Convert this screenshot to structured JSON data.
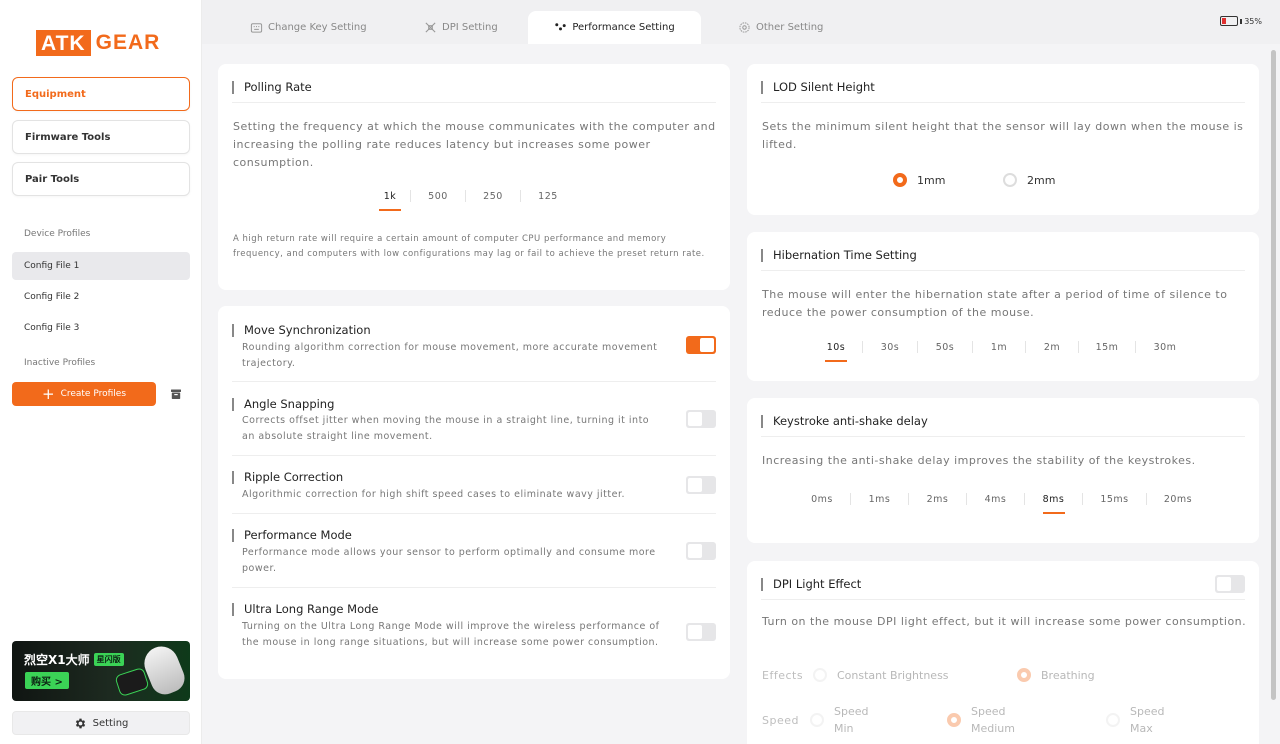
{
  "brand": {
    "logo_left": "ATK",
    "logo_right": "GEAR",
    "accent": "#f26a1b"
  },
  "sidebar": {
    "nav": [
      {
        "label": "Equipment",
        "active": true
      },
      {
        "label": "Firmware Tools"
      },
      {
        "label": "Pair Tools"
      }
    ],
    "device_profiles_label": "Device Profiles",
    "profiles": [
      {
        "label": "Config File 1",
        "active": true
      },
      {
        "label": "Config File 2"
      },
      {
        "label": "Config File 3"
      }
    ],
    "inactive_profiles_label": "Inactive Profiles",
    "create_label": "Create Profiles",
    "banner": {
      "title": "烈空X1大师",
      "badge": "星闪版",
      "buy": "购买 >"
    },
    "setting_label": "Setting"
  },
  "tabs": [
    {
      "label": "Change Key Setting",
      "icon": "keyboard-icon"
    },
    {
      "label": "DPI Setting",
      "icon": "dpi-icon"
    },
    {
      "label": "Performance Setting",
      "icon": "performance-icon",
      "active": true
    },
    {
      "label": "Other Setting",
      "icon": "gear-icon"
    }
  ],
  "battery": {
    "text": "35%",
    "level": 0.35
  },
  "polling": {
    "title": "Polling Rate",
    "desc": "Setting the frequency at which the mouse communicates with the computer and increasing the polling rate reduces latency but increases some power consumption.",
    "options": [
      "1k",
      "500",
      "250",
      "125"
    ],
    "selected": "1k",
    "note": "A high return rate will require a certain amount of computer CPU performance and memory frequency, and computers with low configurations may lag or fail to achieve the preset return rate."
  },
  "toggles": [
    {
      "title": "Move Synchronization",
      "desc": "Rounding algorithm correction for mouse movement, more accurate movement trajectory.",
      "on": true
    },
    {
      "title": "Angle Snapping",
      "desc": "Corrects offset jitter when moving the mouse in a straight line, turning it into an absolute straight line movement.",
      "on": false
    },
    {
      "title": "Ripple Correction",
      "desc": "Algorithmic correction for high shift speed cases to eliminate wavy jitter.",
      "on": false
    },
    {
      "title": "Performance Mode",
      "desc": "Performance mode allows your sensor to perform optimally and consume more power.",
      "on": false
    },
    {
      "title": "Ultra Long Range Mode",
      "desc": "Turning on the Ultra Long Range Mode will improve the wireless performance of the mouse in long range situations, but will increase some power consumption.",
      "on": false
    }
  ],
  "lod": {
    "title": "LOD Silent Height",
    "desc": "Sets the minimum silent height that the sensor will lay down when the mouse is lifted.",
    "options": [
      "1mm",
      "2mm"
    ],
    "selected": "1mm"
  },
  "hibernation": {
    "title": "Hibernation Time Setting",
    "desc": "The mouse will enter the hibernation state after a period of time of silence to reduce the power consumption of the mouse.",
    "options": [
      "10s",
      "30s",
      "50s",
      "1m",
      "2m",
      "15m",
      "30m"
    ],
    "selected": "10s"
  },
  "keystroke": {
    "title": "Keystroke anti-shake delay",
    "desc": "Increasing the anti-shake delay improves the stability of the keystrokes.",
    "options": [
      "0ms",
      "1ms",
      "2ms",
      "4ms",
      "8ms",
      "15ms",
      "20ms"
    ],
    "selected": "8ms"
  },
  "dpi_light": {
    "title": "DPI Light Effect",
    "on": false,
    "desc": "Turn on the mouse DPI light effect, but it will increase some power consumption.",
    "effects_label": "Effects",
    "effects": [
      "Constant Brightness",
      "Breathing"
    ],
    "effect_selected": "Breathing",
    "speed_label": "Speed",
    "speeds": [
      [
        "Speed",
        "Min"
      ],
      [
        "Speed",
        "Medium"
      ],
      [
        "Speed",
        "Max"
      ]
    ],
    "speed_selected": "Medium"
  }
}
